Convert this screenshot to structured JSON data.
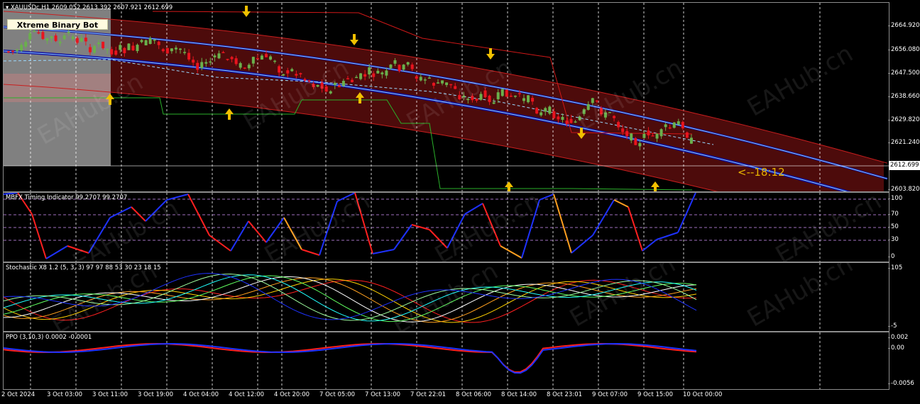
{
  "main_chart": {
    "title": "XAUUSDc,H1  2609.052 2613.392 2607.921 2612.699",
    "bot_label": "Xtreme Binary Bot",
    "countdown": "<--18:12",
    "current_price": "2612.699",
    "price_levels": [
      "2664.920",
      "2656.080",
      "2647.500",
      "2638.660",
      "2629.820",
      "2621.240",
      "2603.820"
    ]
  },
  "mbfx_pane": {
    "title": "MBFX Timing Indicator 99.2707 99.2707",
    "levels": [
      "100",
      "70",
      "50",
      "30",
      "0"
    ]
  },
  "stoch_pane": {
    "title": "Stochastic X8 1.2 (5, 3, 3) 97 97 88 53 30 23 18 15",
    "levels": [
      "105",
      "-5"
    ]
  },
  "ppo_pane": {
    "title": "PPO (3,10,3) 0.0002 -0.0001",
    "levels": [
      "0.002",
      "0.00",
      "-0.0056"
    ]
  },
  "time_labels": [
    "2 Oct 2024",
    "3 Oct 03:00",
    "3 Oct 11:00",
    "3 Oct 19:00",
    "4 Oct 04:00",
    "4 Oct 12:00",
    "4 Oct 20:00",
    "7 Oct 05:00",
    "7 Oct 13:00",
    "7 Oct 22:01",
    "8 Oct 06:00",
    "8 Oct 14:00",
    "8 Oct 23:01",
    "9 Oct 07:00",
    "9 Oct 15:00",
    "10 Oct 00:00"
  ],
  "watermark": "EAHub.cn",
  "colors": {
    "bull": "#6ab04c",
    "bear": "#e8141e",
    "channel_fill": "#5a0d0d",
    "channel_edge": "#c81e1e",
    "aqua_band": "#8fd3ff",
    "navy_band": "#1010a0",
    "arrow": "#f0c000",
    "mbfx_up": "#1e32ff",
    "mbfx_down": "#ff2020",
    "mbfx_mid": "#ffa020",
    "ppo_main": "#1e32ff",
    "ppo_signal": "#ff2020"
  }
}
